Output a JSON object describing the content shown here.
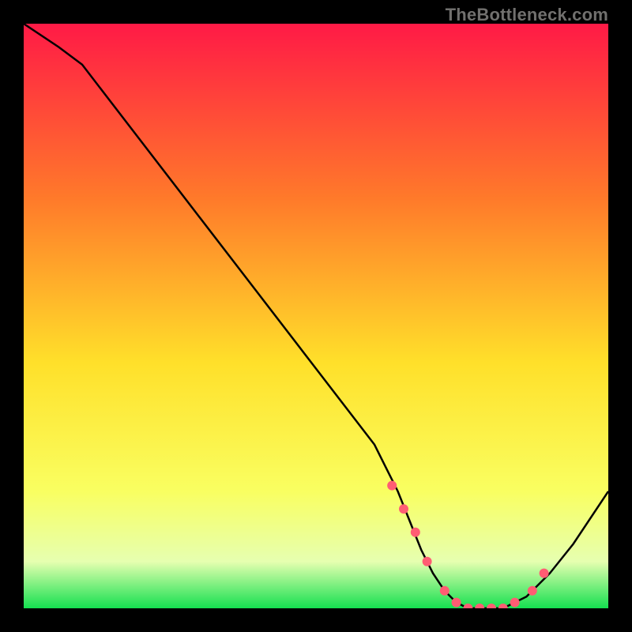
{
  "watermark": "TheBottleneck.com",
  "colors": {
    "top": "#ff1a46",
    "mid1": "#ff7a2a",
    "mid2": "#ffe02a",
    "low": "#f9ff61",
    "band": "#e6ffb0",
    "bottom": "#15e050",
    "curve": "#000000",
    "marker": "#ff5d73"
  },
  "chart_data": {
    "type": "line",
    "title": "",
    "xlabel": "",
    "ylabel": "",
    "xlim": [
      0,
      100
    ],
    "ylim": [
      0,
      100
    ],
    "curve": {
      "x": [
        0,
        6,
        10,
        20,
        30,
        40,
        50,
        60,
        62,
        64,
        66,
        68,
        70,
        72,
        74,
        76,
        78,
        80,
        82,
        84,
        86,
        90,
        94,
        100
      ],
      "y": [
        100,
        96,
        93,
        80,
        67,
        54,
        41,
        28,
        24,
        20,
        15,
        10,
        6,
        3,
        1,
        0,
        0,
        0,
        0,
        1,
        2,
        6,
        11,
        20
      ]
    },
    "markers": {
      "x": [
        63,
        65,
        67,
        69,
        72,
        74,
        76,
        78,
        80,
        82,
        84,
        87,
        89
      ],
      "y": [
        21,
        17,
        13,
        8,
        3,
        1,
        0,
        0,
        0,
        0,
        1,
        3,
        6
      ]
    }
  }
}
